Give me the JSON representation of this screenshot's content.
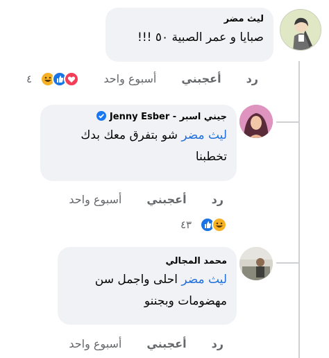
{
  "comments": [
    {
      "author": "ليث مضر",
      "text": "صبايا و عمر الصبية ٥٠ !!!",
      "time": "أسبوع واحد",
      "like_label": "أعجبني",
      "reply_label": "رد",
      "reaction_count": "٤",
      "reactions": [
        "haha-icon",
        "like-icon",
        "love-icon"
      ]
    },
    {
      "author": "جيني اسبر - Jenny Esber",
      "verified": true,
      "mention": "ليث مضر",
      "text_line1": "شو بتفرق معك بدك",
      "text_line2": "تخطبنا",
      "time": "أسبوع واحد",
      "like_label": "أعجبني",
      "reply_label": "رد",
      "reaction_count": "٤٣",
      "reactions": [
        "haha-icon",
        "like-icon"
      ]
    },
    {
      "author": "محمد المجالي",
      "mention": "ليث مضر",
      "text_line1": "احلى واجمل سن",
      "text_line2": "مهضومات وبجننو",
      "time": "أسبوع واحد",
      "like_label": "أعجبني",
      "reply_label": "رد"
    }
  ],
  "colors": {
    "bubble_bg": "#f0f2f5",
    "mention": "#216fdb",
    "meta": "#65676b",
    "thread_line": "#ced0d4"
  }
}
